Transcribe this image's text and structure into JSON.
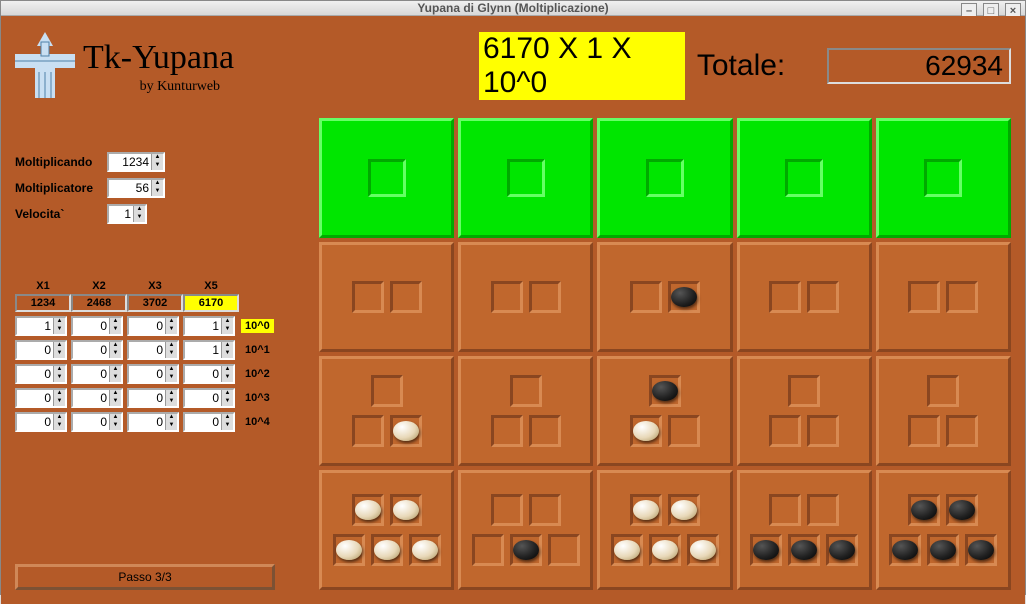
{
  "window_title": "Yupana di Glynn (Moltiplicazione)",
  "app_name": "Tk-Yupana",
  "byline": "by Kunturweb",
  "inputs": {
    "moltiplicando": {
      "label": "Moltiplicando",
      "value": "1234"
    },
    "moltiplicatore": {
      "label": "Moltiplicatore",
      "value": "56"
    },
    "velocita": {
      "label": "Velocita`",
      "value": "1"
    }
  },
  "xtable": {
    "headers": [
      "X1",
      "X2",
      "X3",
      "X5"
    ],
    "multipliers": [
      "1234",
      "2468",
      "3702",
      "6170"
    ],
    "highlight_mult": 3,
    "rows": [
      {
        "cells": [
          "1",
          "0",
          "0",
          "1"
        ],
        "power": "10^0",
        "highlight": true
      },
      {
        "cells": [
          "0",
          "0",
          "0",
          "1"
        ],
        "power": "10^1",
        "highlight": false
      },
      {
        "cells": [
          "0",
          "0",
          "0",
          "0"
        ],
        "power": "10^2",
        "highlight": false
      },
      {
        "cells": [
          "0",
          "0",
          "0",
          "0"
        ],
        "power": "10^3",
        "highlight": false
      },
      {
        "cells": [
          "0",
          "0",
          "0",
          "0"
        ],
        "power": "10^4",
        "highlight": false
      }
    ]
  },
  "passo_label": "Passo 3/3",
  "operation": "6170 X 1 X 10^0",
  "totale_label": "Totale:",
  "totale_value": "62934",
  "board": [
    [
      {
        "g": true,
        "rows": [
          [
            ""
          ]
        ]
      },
      {
        "g": true,
        "rows": [
          [
            ""
          ]
        ]
      },
      {
        "g": true,
        "rows": [
          [
            ""
          ]
        ]
      },
      {
        "g": true,
        "rows": [
          [
            ""
          ]
        ]
      },
      {
        "g": true,
        "rows": [
          [
            ""
          ]
        ]
      }
    ],
    [
      {
        "rows": [
          [
            "",
            ""
          ]
        ]
      },
      {
        "rows": [
          [
            "",
            ""
          ]
        ]
      },
      {
        "rows": [
          [
            "",
            "b"
          ]
        ]
      },
      {
        "rows": [
          [
            "",
            ""
          ]
        ]
      },
      {
        "rows": [
          [
            "",
            ""
          ]
        ]
      }
    ],
    [
      {
        "rows": [
          [
            ""
          ],
          [
            "",
            "w"
          ]
        ]
      },
      {
        "rows": [
          [
            ""
          ],
          [
            "",
            ""
          ]
        ]
      },
      {
        "rows": [
          [
            "b"
          ],
          [
            "w",
            ""
          ]
        ]
      },
      {
        "rows": [
          [
            ""
          ],
          [
            "",
            ""
          ]
        ]
      },
      {
        "rows": [
          [
            ""
          ],
          [
            "",
            ""
          ]
        ]
      }
    ],
    [
      {
        "rows": [
          [
            "w",
            "w"
          ],
          [
            "w",
            "w",
            "w"
          ]
        ]
      },
      {
        "rows": [
          [
            "",
            ""
          ],
          [
            "",
            "b",
            ""
          ]
        ]
      },
      {
        "rows": [
          [
            "w",
            "w"
          ],
          [
            "w",
            "w",
            "w"
          ]
        ]
      },
      {
        "rows": [
          [
            "",
            ""
          ],
          [
            "b",
            "b",
            "b"
          ]
        ]
      },
      {
        "rows": [
          [
            "b",
            "b"
          ],
          [
            "b",
            "b",
            "b"
          ]
        ]
      }
    ]
  ]
}
